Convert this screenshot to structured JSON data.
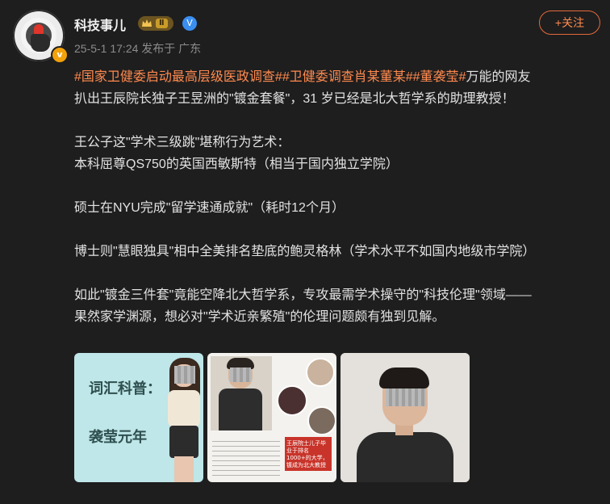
{
  "header": {
    "username": "科技事儿",
    "level_badge": "Ⅱ",
    "verify_badge": "V",
    "meta": "25-5-1 17:24 发布于 广东",
    "follow_label": "+关注"
  },
  "post": {
    "line1": {
      "tag1": "#国家卫健委启动最高层级医政调查#",
      "tag2": "#卫健委调查肖某董某#",
      "tag3": "#董袭莹#",
      "text": "万能的网友"
    },
    "line2": "扒出王辰院长独子王昱洲的\"镀金套餐\"，31 岁已经是北大哲学系的助理教授！",
    "para2_line1": "王公子这\"学术三级跳\"堪称行为艺术：",
    "para2_line2": "本科屈尊QS750的英国西敏斯特（相当于国内独立学院）",
    "para3": "硕士在NYU完成\"留学速通成就\"（耗时12个月）",
    "para4": "博士则\"慧眼独具\"相中全美排名垫底的鲍灵格林（学术水平不如国内地级市学院）",
    "para5_line1": "如此\"镀金三件套\"竟能空降北大哲学系，专攻最需学术操守的\"科技伦理\"领域——",
    "para5_line2": "果然家学渊源，想必对\"学术近亲繁殖\"的伦理问题颇有独到见解。"
  },
  "images": {
    "img1_word1": "词汇科普：",
    "img1_word2": "袭莹元年",
    "img2_red": "王辰院士儿子毕业于排名1000+的大学，镀成为北大教授"
  },
  "colors": {
    "background": "#1e1e1e",
    "accent": "#ff8a4f",
    "text": "#e2e2e2",
    "muted": "#8c8c8c"
  }
}
